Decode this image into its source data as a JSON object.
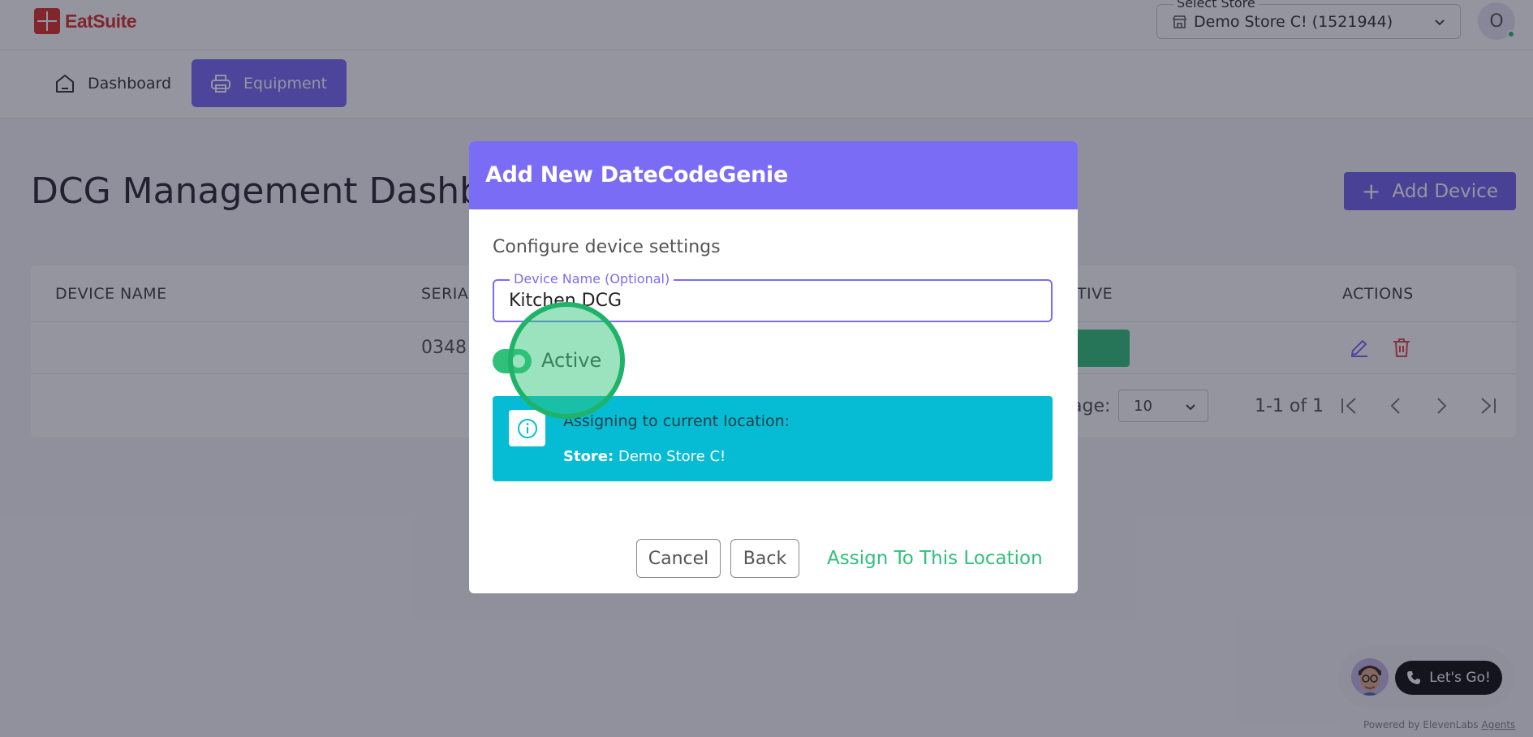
{
  "header": {
    "brand": "EatSuite",
    "store_select": {
      "legend": "Select Store",
      "value": "Demo Store C! (1521944)"
    },
    "avatar_initial": "O"
  },
  "nav": {
    "items": [
      {
        "label": "Dashboard",
        "icon": "home-icon",
        "active": false
      },
      {
        "label": "Equipment",
        "icon": "printer-icon",
        "active": true
      }
    ]
  },
  "page": {
    "title": "DCG Management Dashboard",
    "add_device_label": "Add Device"
  },
  "table": {
    "columns": [
      "DEVICE NAME",
      "SERIAL",
      "ACTIVE",
      "ACTIONS"
    ],
    "rows": [
      {
        "serial": "0348"
      }
    ],
    "pager": {
      "rows_label": "age:",
      "rows_per_page": "10",
      "range": "1-1 of 1"
    }
  },
  "dialog": {
    "title": "Add New DateCodeGenie",
    "subtitle": "Configure device settings",
    "device_name_legend": "Device Name (Optional)",
    "device_name_value": "Kitchen DCG",
    "active_label": "Active",
    "info_line1": "Assigning to current location:",
    "info_store_label": "Store:",
    "info_store_value": "Demo Store C!",
    "cancel_label": "Cancel",
    "back_label": "Back",
    "assign_label": "Assign To This Location"
  },
  "voice_widget": {
    "button_label": "Let's Go!",
    "powered_prefix": "Powered by ElevenLabs",
    "powered_link": "Agents"
  },
  "colors": {
    "primary": "#7b6cf6",
    "success": "#2fc07a",
    "info": "#06bcd4",
    "danger": "#e04a4a",
    "brand": "#d8322a"
  }
}
